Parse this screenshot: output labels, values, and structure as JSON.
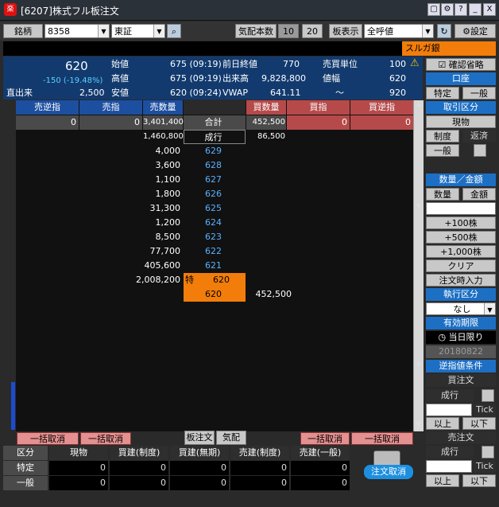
{
  "window": {
    "title": "[6207]株式フル板注文",
    "icon_label": "楽",
    "controls": [
      "▢",
      "⚙",
      "?",
      "_",
      "X"
    ]
  },
  "toolbar": {
    "code_label": "銘柄",
    "code_value": "8358",
    "market_value": "東証",
    "quote_label": "気配本数",
    "quote_10": "10",
    "quote_20": "20",
    "board_label": "板表示",
    "board_value": "全呼値",
    "settings_label": "設定"
  },
  "stock": {
    "name_tag": "スルガ銀"
  },
  "info": {
    "price": "620",
    "change": "-150 (-19.48%)",
    "volume_label": "直出来",
    "volume_value": "2,500",
    "open_label": "始値",
    "open_value": "675 (09:19)",
    "high_label": "高値",
    "high_value": "675 (09:19)",
    "low_label": "安値",
    "low_value": "620 (09:24)",
    "prev_label": "前日終値",
    "prev_value": "770",
    "turnover_label": "出来高",
    "turnover_value": "9,828,800",
    "vwap_label": "VWAP",
    "vwap_value": "641.11",
    "unit_label": "売買単位",
    "unit_value": "100",
    "range_label": "値幅",
    "range_value": "620",
    "range_hi": "920",
    "tilde": "〜"
  },
  "board": {
    "headers": [
      "売逆指",
      "売指",
      "売数量",
      "",
      "買数量",
      "買指",
      "買逆指"
    ],
    "total_row": {
      "sell_stop": "0",
      "sell_limit": "0",
      "sell_qty": "3,401,400",
      "label": "合計",
      "buy_qty": "452,500",
      "buy_limit": "0",
      "buy_stop": "0"
    },
    "market_row": {
      "sell_qty": "1,460,800",
      "label": "成行",
      "buy_qty": "86,500"
    },
    "rows": [
      {
        "qty": "4,000",
        "price": "629"
      },
      {
        "qty": "3,600",
        "price": "628"
      },
      {
        "qty": "1,100",
        "price": "627"
      },
      {
        "qty": "1,800",
        "price": "626"
      },
      {
        "qty": "31,300",
        "price": "625"
      },
      {
        "qty": "1,200",
        "price": "624"
      },
      {
        "qty": "8,500",
        "price": "623"
      },
      {
        "qty": "77,700",
        "price": "622"
      },
      {
        "qty": "405,600",
        "price": "621"
      }
    ],
    "special_row": {
      "qty": "2,008,200",
      "tag": "特",
      "price": "620"
    },
    "buy_row": {
      "price": "620",
      "qty": "452,500"
    },
    "cancel_all": "一括取消",
    "board_order": "板注文",
    "quote_btn": "気配"
  },
  "right": {
    "confirm": "確認省略",
    "account": "口座",
    "tokutei": "特定",
    "ippan": "一般",
    "trade_type": "取引区分",
    "genbutsu": "現物",
    "seido": "制度",
    "hensai": "返済",
    "ippan2": "一般",
    "qty_amt": "数量／金額",
    "qty": "数量",
    "amt": "金額",
    "add100": "+100株",
    "add500": "+500株",
    "add1000": "+1,000株",
    "clear": "クリア",
    "order_time": "注文時入力",
    "exec": "執行区分",
    "exec_value": "なし",
    "validity": "有効期限",
    "today": "当日限り",
    "date": "20180822",
    "stop_cond": "逆指値条件",
    "buy_order": "買注文",
    "nariyuki": "成行",
    "tick": "Tick",
    "above": "以上",
    "below": "以下",
    "sell_order": "売注文",
    "nariyuki2": "成行",
    "tick2": "Tick",
    "above2": "以上",
    "below2": "以下"
  },
  "bottom": {
    "headers": [
      "区分",
      "現物",
      "買建(制度)",
      "買建(無期)",
      "売建(制度)",
      "売建(一般)"
    ],
    "rows": [
      {
        "label": "特定",
        "values": [
          "0",
          "0",
          "0",
          "0",
          "0"
        ]
      },
      {
        "label": "一般",
        "values": [
          "0",
          "0",
          "0",
          "0",
          "0"
        ]
      }
    ],
    "cancel_order": "注文取消"
  }
}
